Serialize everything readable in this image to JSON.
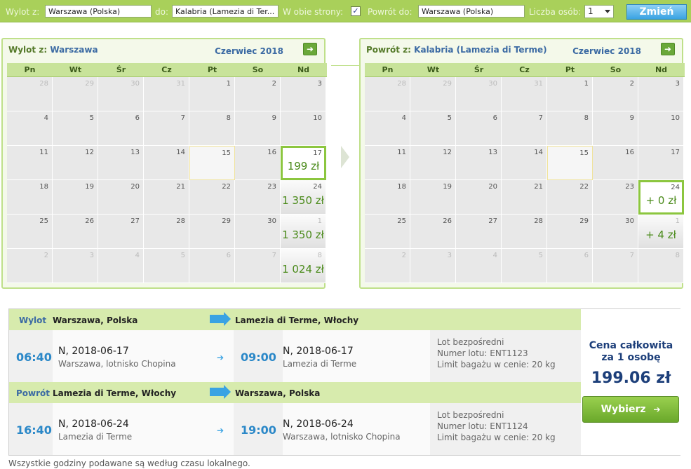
{
  "search": {
    "from_label": "Wylot z:",
    "from_value": "Warszawa (Polska)",
    "to_label": "do:",
    "to_value": "Kalabria (Lamezia di Ter...",
    "roundtrip_label": "W obie strony:",
    "roundtrip_checked": "✓",
    "return_label": "Powrót do:",
    "return_value": "Warszawa (Polska)",
    "pax_label": "Liczba osób:",
    "pax_value": "1",
    "submit": "Zmień"
  },
  "outbound_cal": {
    "title_prefix": "Wylot z:",
    "title_city": "Warszawa",
    "month": "Czerwiec 2018",
    "next_icon": "➜"
  },
  "return_cal": {
    "title_prefix": "Powrót z:",
    "title_city": "Kalabria (Lamezia di Terme)",
    "month": "Czerwiec 2018",
    "next_icon": "➜"
  },
  "weekdays": [
    "Pn",
    "Wt",
    "Śr",
    "Cz",
    "Pt",
    "So",
    "Nd"
  ],
  "outbound_weeks": [
    [
      {
        "d": "28",
        "o": 1
      },
      {
        "d": "29",
        "o": 1
      },
      {
        "d": "30",
        "o": 1
      },
      {
        "d": "31",
        "o": 1
      },
      {
        "d": "1"
      },
      {
        "d": "2"
      },
      {
        "d": "3"
      }
    ],
    [
      {
        "d": "4"
      },
      {
        "d": "5"
      },
      {
        "d": "6"
      },
      {
        "d": "7"
      },
      {
        "d": "8"
      },
      {
        "d": "9"
      },
      {
        "d": "10"
      }
    ],
    [
      {
        "d": "11"
      },
      {
        "d": "12"
      },
      {
        "d": "13"
      },
      {
        "d": "14"
      },
      {
        "d": "15",
        "t": 1
      },
      {
        "d": "16"
      },
      {
        "d": "17",
        "p": "199 zł",
        "s": 1
      }
    ],
    [
      {
        "d": "18"
      },
      {
        "d": "19"
      },
      {
        "d": "20"
      },
      {
        "d": "21"
      },
      {
        "d": "22"
      },
      {
        "d": "23"
      },
      {
        "d": "24",
        "p": "1 350 zł"
      }
    ],
    [
      {
        "d": "25"
      },
      {
        "d": "26"
      },
      {
        "d": "27"
      },
      {
        "d": "28"
      },
      {
        "d": "29"
      },
      {
        "d": "30"
      },
      {
        "d": "1",
        "o": 1,
        "p": "1 350 zł"
      }
    ],
    [
      {
        "d": "2",
        "o": 1
      },
      {
        "d": "3",
        "o": 1
      },
      {
        "d": "4",
        "o": 1
      },
      {
        "d": "5",
        "o": 1
      },
      {
        "d": "6",
        "o": 1
      },
      {
        "d": "7",
        "o": 1
      },
      {
        "d": "8",
        "o": 1,
        "p": "1 024 zł"
      }
    ]
  ],
  "return_weeks": [
    [
      {
        "d": "28",
        "o": 1
      },
      {
        "d": "29",
        "o": 1
      },
      {
        "d": "30",
        "o": 1
      },
      {
        "d": "31",
        "o": 1
      },
      {
        "d": "1"
      },
      {
        "d": "2"
      },
      {
        "d": "3"
      }
    ],
    [
      {
        "d": "4"
      },
      {
        "d": "5"
      },
      {
        "d": "6"
      },
      {
        "d": "7"
      },
      {
        "d": "8"
      },
      {
        "d": "9"
      },
      {
        "d": "10"
      }
    ],
    [
      {
        "d": "11"
      },
      {
        "d": "12"
      },
      {
        "d": "13"
      },
      {
        "d": "14"
      },
      {
        "d": "15",
        "t": 1
      },
      {
        "d": "16"
      },
      {
        "d": "17"
      }
    ],
    [
      {
        "d": "18"
      },
      {
        "d": "19"
      },
      {
        "d": "20"
      },
      {
        "d": "21"
      },
      {
        "d": "22"
      },
      {
        "d": "23"
      },
      {
        "d": "24",
        "p": "+ 0 zł",
        "s": 1
      }
    ],
    [
      {
        "d": "25"
      },
      {
        "d": "26"
      },
      {
        "d": "27"
      },
      {
        "d": "28"
      },
      {
        "d": "29"
      },
      {
        "d": "30"
      },
      {
        "d": "1",
        "o": 1,
        "p": "+ 4 zł"
      }
    ],
    [
      {
        "d": "2",
        "o": 1
      },
      {
        "d": "3",
        "o": 1
      },
      {
        "d": "4",
        "o": 1
      },
      {
        "d": "5",
        "o": 1
      },
      {
        "d": "6",
        "o": 1
      },
      {
        "d": "7",
        "o": 1
      },
      {
        "d": "8",
        "o": 1
      }
    ]
  ],
  "summary": {
    "outbound": {
      "label": "Wylot",
      "from_city": "Warszawa, Polska",
      "to_city": "Lamezia di Terme, Włochy",
      "dep_time": "06:40",
      "dep_date": "N, 2018-06-17",
      "dep_place": "Warszawa, lotnisko Chopina",
      "arr_time": "09:00",
      "arr_date": "N, 2018-06-17",
      "arr_place": "Lamezia di Terme",
      "info1": "Lot bezpośredni",
      "info2": "Numer lotu: ENT1123",
      "info3": "Limit bagażu w cenie: 20 kg"
    },
    "return": {
      "label": "Powrót",
      "from_city": "Lamezia di Terme, Włochy",
      "to_city": "Warszawa, Polska",
      "dep_time": "16:40",
      "dep_date": "N, 2018-06-24",
      "dep_place": "Lamezia di Terme",
      "arr_time": "19:00",
      "arr_date": "N, 2018-06-24",
      "arr_place": "Warszawa, lotnisko Chopina",
      "info1": "Lot bezpośredni",
      "info2": "Numer lotu: ENT1124",
      "info3": "Limit bagażu w cenie: 20 kg"
    },
    "small_arrow": "➔",
    "total_line1": "Cena całkowita",
    "total_line2": "za 1 osobę",
    "total_amount": "199.06 zł",
    "select_button": "Wybierz",
    "select_icon": "➔"
  },
  "footnote": "Wszystkie godziny podawane są według czasu lokalnego."
}
